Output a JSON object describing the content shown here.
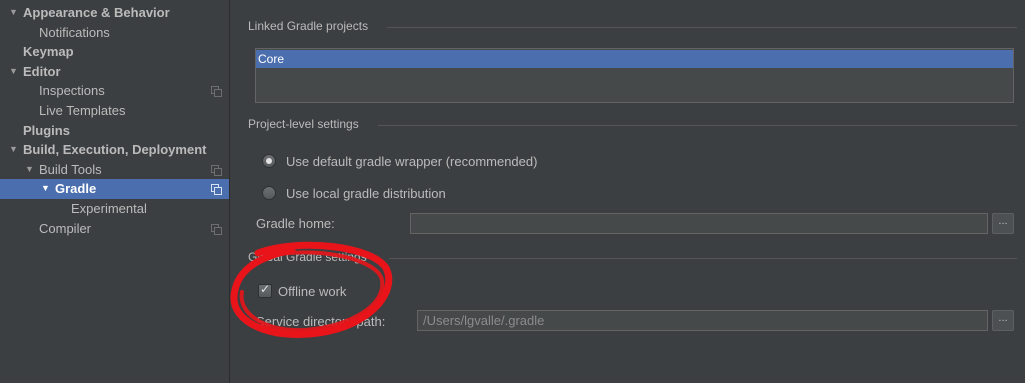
{
  "sidebar": {
    "items": [
      {
        "label": "Appearance & Behavior",
        "arrow": "▼"
      },
      {
        "label": "Notifications"
      },
      {
        "label": "Keymap"
      },
      {
        "label": "Editor",
        "arrow": "▼"
      },
      {
        "label": "Inspections"
      },
      {
        "label": "Live Templates"
      },
      {
        "label": "Plugins"
      },
      {
        "label": "Build, Execution, Deployment",
        "arrow": "▼"
      },
      {
        "label": "Build Tools",
        "arrow": "▼"
      },
      {
        "label": "Gradle",
        "arrow": "▼"
      },
      {
        "label": "Experimental"
      },
      {
        "label": "Compiler"
      }
    ]
  },
  "main": {
    "linked_projects": {
      "title": "Linked Gradle projects",
      "items": [
        "Core"
      ]
    },
    "project_settings": {
      "title": "Project-level settings",
      "radio_default": "Use default gradle wrapper (recommended)",
      "radio_local": "Use local gradle distribution",
      "gradle_home_label": "Gradle home:",
      "gradle_home_value": "",
      "browse_label": "..."
    },
    "global_settings": {
      "title": "Global Gradle settings",
      "offline_label": "Offline work",
      "offline_checked": true,
      "service_dir_label": "Service directory path:",
      "service_dir_value": "/Users/lgvalle/.gradle",
      "browse_label": "..."
    }
  },
  "colors": {
    "background": "#3c3f41",
    "selection": "#4b6eaf",
    "annotation": "#e8141a"
  }
}
